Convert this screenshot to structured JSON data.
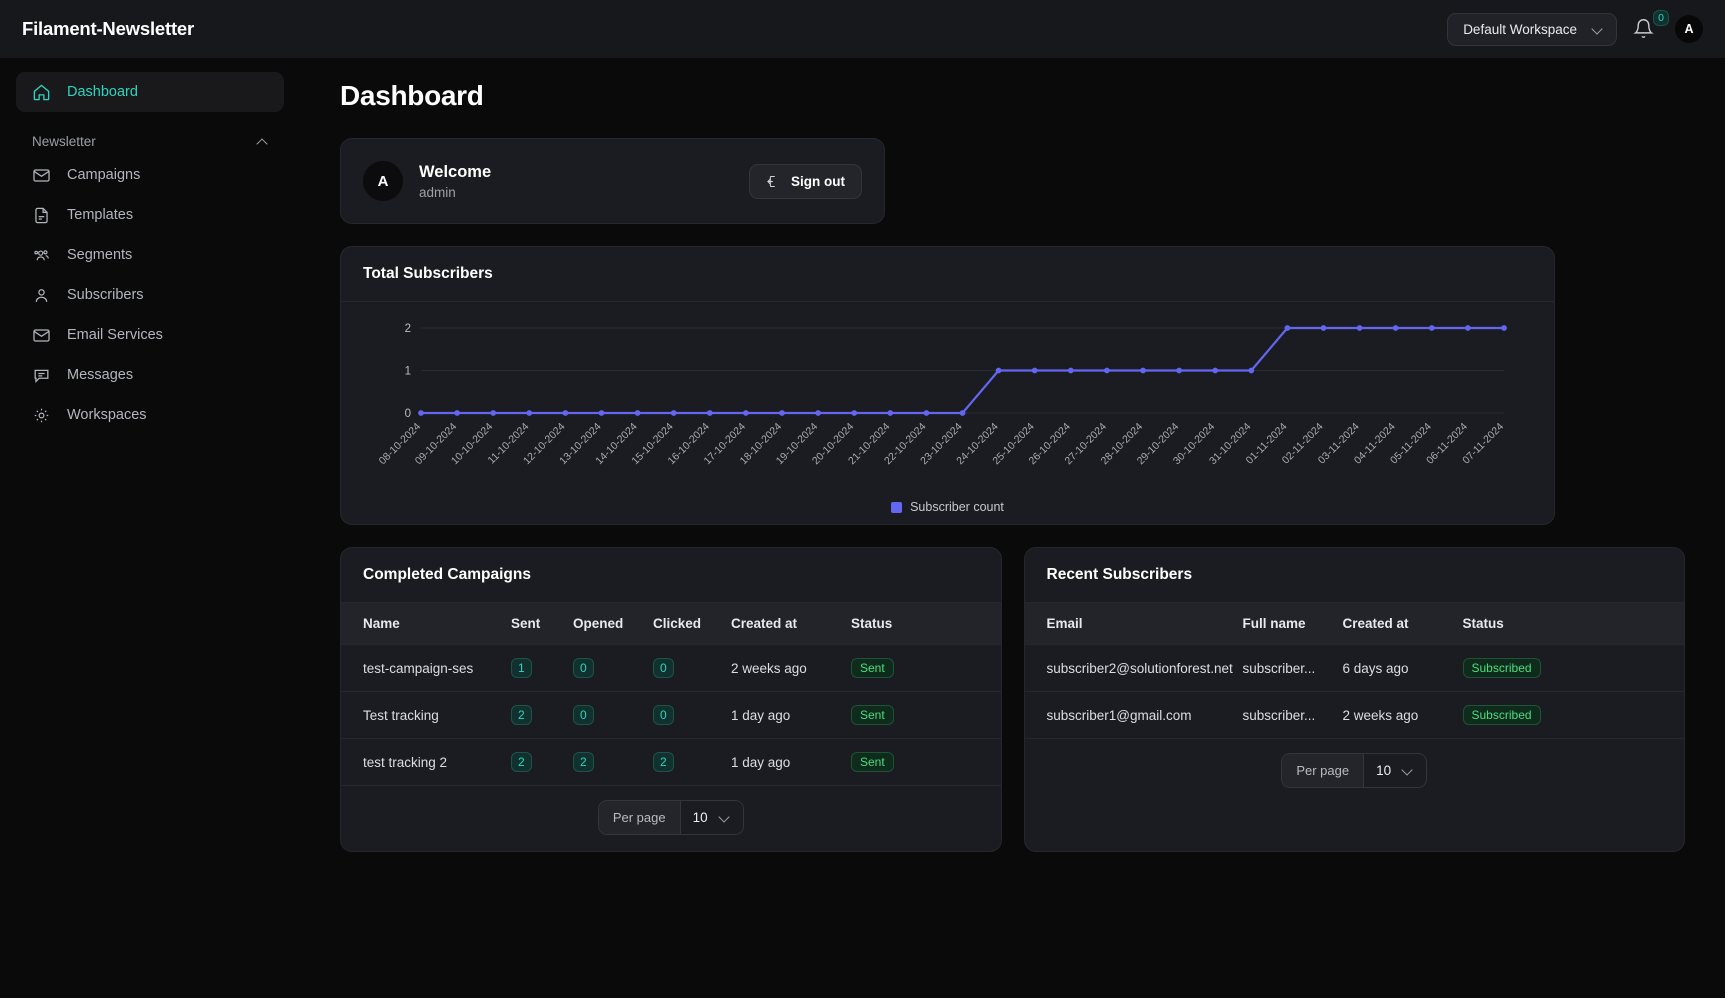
{
  "topbar": {
    "brand": "Filament-Newsletter",
    "workspace_label": "Default Workspace",
    "notification_count": "0",
    "avatar_initial": "A",
    "icons": {
      "chevron": "chevron-down-icon",
      "bell": "bell-icon"
    }
  },
  "sidebar": {
    "dashboard": {
      "label": "Dashboard",
      "icon": "home-icon"
    },
    "group_label": "Newsletter",
    "items": [
      {
        "label": "Campaigns",
        "icon": "envelope-icon"
      },
      {
        "label": "Templates",
        "icon": "document-icon"
      },
      {
        "label": "Segments",
        "icon": "users-group-icon"
      },
      {
        "label": "Subscribers",
        "icon": "user-icon"
      },
      {
        "label": "Email Services",
        "icon": "envelope-icon"
      },
      {
        "label": "Messages",
        "icon": "chat-bubble-icon"
      },
      {
        "label": "Workspaces",
        "icon": "gear-icon"
      }
    ]
  },
  "page": {
    "title": "Dashboard"
  },
  "welcome": {
    "avatar_initial": "A",
    "title": "Welcome",
    "subtitle": "admin",
    "signout_label": "Sign out"
  },
  "chart_card": {
    "title": "Total Subscribers"
  },
  "chart_data": {
    "type": "line",
    "title": "Total Subscribers",
    "xlabel": "",
    "ylabel": "",
    "ylim": [
      0,
      2
    ],
    "yticks": [
      0,
      1,
      2
    ],
    "grid": true,
    "legend_position": "bottom",
    "legend": [
      "Subscriber count"
    ],
    "series_color": "#6366f1",
    "categories": [
      "08-10-2024",
      "09-10-2024",
      "10-10-2024",
      "11-10-2024",
      "12-10-2024",
      "13-10-2024",
      "14-10-2024",
      "15-10-2024",
      "16-10-2024",
      "17-10-2024",
      "18-10-2024",
      "19-10-2024",
      "20-10-2024",
      "21-10-2024",
      "22-10-2024",
      "23-10-2024",
      "24-10-2024",
      "25-10-2024",
      "26-10-2024",
      "27-10-2024",
      "28-10-2024",
      "29-10-2024",
      "30-10-2024",
      "31-10-2024",
      "01-11-2024",
      "02-11-2024",
      "03-11-2024",
      "04-11-2024",
      "05-11-2024",
      "06-11-2024",
      "07-11-2024"
    ],
    "series": [
      {
        "name": "Subscriber count",
        "values": [
          0,
          0,
          0,
          0,
          0,
          0,
          0,
          0,
          0,
          0,
          0,
          0,
          0,
          0,
          0,
          0,
          1,
          1,
          1,
          1,
          1,
          1,
          1,
          1,
          2,
          2,
          2,
          2,
          2,
          2,
          2
        ]
      }
    ]
  },
  "campaigns_card": {
    "title": "Completed Campaigns",
    "columns": [
      "Name",
      "Sent",
      "Opened",
      "Clicked",
      "Created at",
      "Status"
    ],
    "rows": [
      {
        "name": "test-campaign-ses",
        "sent": "1",
        "opened": "0",
        "clicked": "0",
        "created_at": "2 weeks ago",
        "status": "Sent"
      },
      {
        "name": "Test tracking",
        "sent": "2",
        "opened": "0",
        "clicked": "0",
        "created_at": "1 day ago",
        "status": "Sent"
      },
      {
        "name": "test tracking 2",
        "sent": "2",
        "opened": "2",
        "clicked": "2",
        "created_at": "1 day ago",
        "status": "Sent"
      }
    ],
    "per_page_label": "Per page",
    "per_page_value": "10"
  },
  "subscribers_card": {
    "title": "Recent Subscribers",
    "columns": [
      "Email",
      "Full name",
      "Created at",
      "Status"
    ],
    "rows": [
      {
        "email": "subscriber2@solutionforest.net",
        "full_name": "subscriber...",
        "created_at": "6 days ago",
        "status": "Subscribed"
      },
      {
        "email": "subscriber1@gmail.com",
        "full_name": "subscriber...",
        "created_at": "2 weeks ago",
        "status": "Subscribed"
      }
    ],
    "per_page_label": "Per page",
    "per_page_value": "10"
  },
  "colors": {
    "accent": "#2dd4bf",
    "chart_line": "#6366f1",
    "status_green": "#4ade80",
    "page_bg": "#0a0a0b",
    "card_bg": "#1b1c21"
  }
}
